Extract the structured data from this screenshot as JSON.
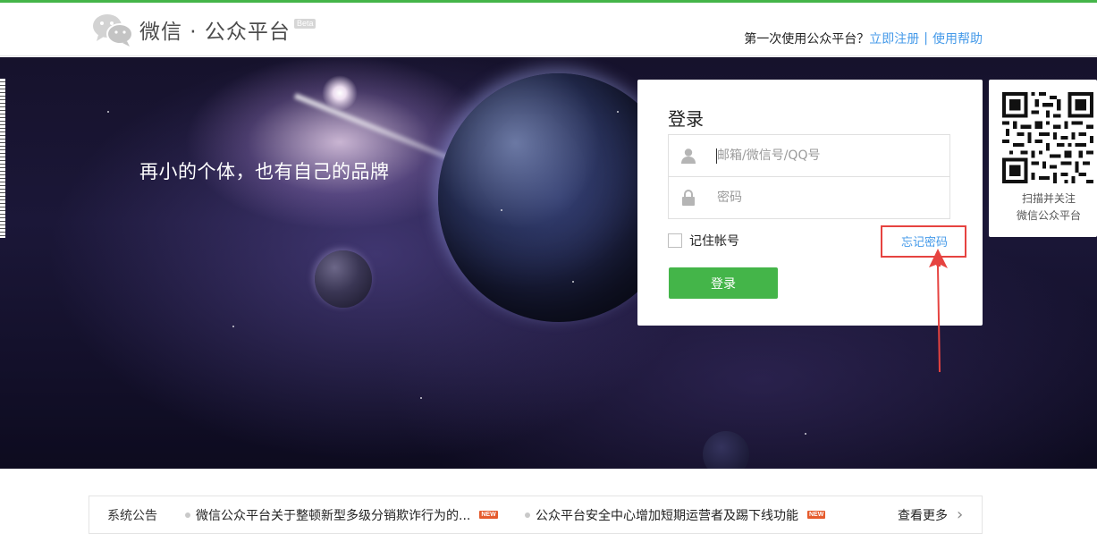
{
  "header": {
    "logo_text": "微信 · 公众平台",
    "beta_badge": "Beta",
    "first_time_text": "第一次使用公众平台？",
    "register_link": "立即注册",
    "separator": "|",
    "help_link": "使用帮助"
  },
  "hero": {
    "tagline": "再小的个体，也有自己的品牌"
  },
  "login": {
    "title": "登录",
    "account_placeholder": "邮箱/微信号/QQ号",
    "password_placeholder": "密码",
    "remember_label": "记住帐号",
    "forgot_link": "忘记密码",
    "submit_label": "登录"
  },
  "qr": {
    "line1": "扫描并关注",
    "line2": "微信公众平台"
  },
  "notice": {
    "title": "系统公告",
    "items": [
      {
        "text": "微信公众平台关于整顿新型多级分销欺诈行为的...",
        "badge": "NEW"
      },
      {
        "text": "公众平台安全中心增加短期运营者及踢下线功能",
        "badge": "NEW"
      }
    ],
    "more_label": "查看更多",
    "more_icon": "chevron-right-icon"
  },
  "colors": {
    "brand_green": "#44b549",
    "link_blue": "#459ae9",
    "annotation_red": "#e64340"
  }
}
